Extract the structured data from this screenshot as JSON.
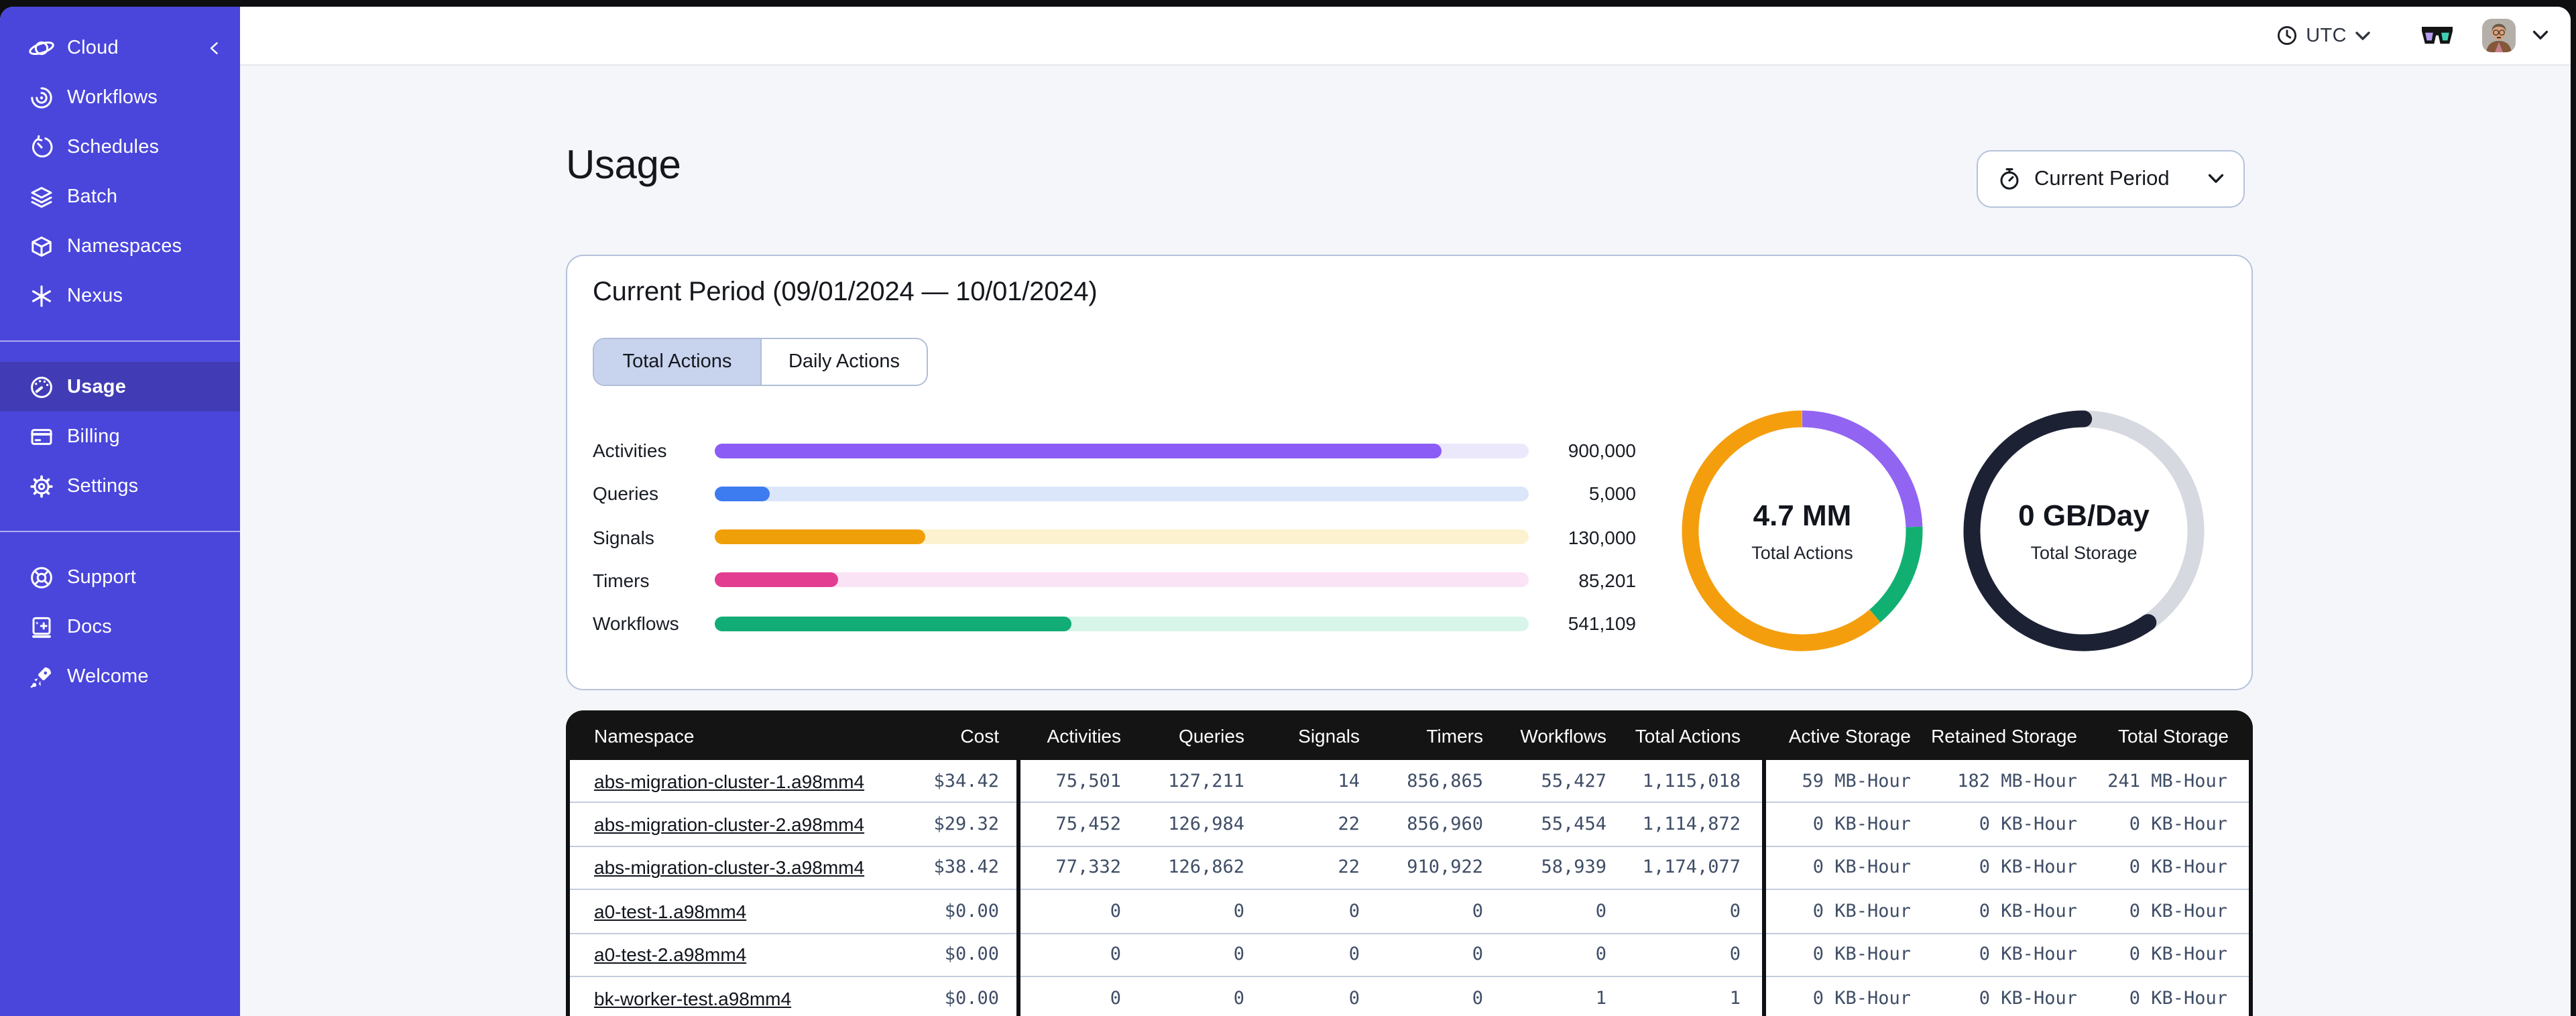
{
  "topbar": {
    "timezone_label": "UTC"
  },
  "sidebar": {
    "header": {
      "label": "Cloud"
    },
    "primary": [
      {
        "label": "Workflows"
      },
      {
        "label": "Schedules"
      },
      {
        "label": "Batch"
      },
      {
        "label": "Namespaces"
      },
      {
        "label": "Nexus"
      }
    ],
    "account": [
      {
        "label": "Usage",
        "active": true
      },
      {
        "label": "Billing",
        "active": false
      },
      {
        "label": "Settings",
        "active": false
      }
    ],
    "help": [
      {
        "label": "Support"
      },
      {
        "label": "Docs"
      },
      {
        "label": "Welcome"
      }
    ]
  },
  "page": {
    "title": "Usage",
    "period_selector_label": "Current Period"
  },
  "usage_card": {
    "title": "Current Period (09/01/2024 — 10/01/2024)",
    "tabs": [
      {
        "label": "Total Actions",
        "active": true
      },
      {
        "label": "Daily Actions",
        "active": false
      }
    ]
  },
  "chart_data": [
    {
      "type": "bar",
      "orientation": "horizontal",
      "title": "Actions by type (current period)",
      "categories": [
        "Activities",
        "Queries",
        "Signals",
        "Timers",
        "Workflows"
      ],
      "values": [
        900000,
        5000,
        130000,
        85201,
        541109
      ],
      "value_labels": [
        "900,000",
        "5,000",
        "130,000",
        "85,201",
        "541,109"
      ],
      "fill_fractions": [
        0.893,
        0.067,
        0.258,
        0.152,
        0.439
      ],
      "bar_colors": [
        "#8b5cf6",
        "#3d7cf0",
        "#ef9f08",
        "#e33d92",
        "#12ac77"
      ],
      "track_colors": [
        "#ece8fc",
        "#dbe6fa",
        "#fdf2cf",
        "#fbe3f6",
        "#d8f5e9"
      ]
    },
    {
      "type": "pie",
      "variant": "donut",
      "center_value": "4.7 MM",
      "center_label": "Total Actions",
      "segments": [
        {
          "name": "activities",
          "color": "#9264f2",
          "start_deg": 0,
          "end_deg": 88
        },
        {
          "name": "workflows",
          "color": "#12af72",
          "start_deg": 88,
          "end_deg": 139.5
        },
        {
          "name": "signals",
          "color": "#f49e0d",
          "start_deg": 139.5,
          "end_deg": 360
        }
      ]
    },
    {
      "type": "pie",
      "variant": "donut",
      "center_value": "0 GB/Day",
      "center_label": "Total Storage",
      "base_color": "#d6d9df",
      "segments": [
        {
          "name": "storage-used",
          "color": "#1c2134",
          "start_deg": 145,
          "end_deg": 360,
          "linecap": "round"
        }
      ]
    }
  ],
  "table": {
    "columns": [
      "Namespace",
      "Cost",
      "Activities",
      "Queries",
      "Signals",
      "Timers",
      "Workflows",
      "Total Actions",
      "Active Storage",
      "Retained Storage",
      "Total Storage"
    ],
    "rows": [
      [
        "abs-migration-cluster-1.a98mm4",
        "$34.42",
        "75,501",
        "127,211",
        "14",
        "856,865",
        "55,427",
        "1,115,018",
        "59 MB-Hour",
        "182 MB-Hour",
        "241 MB-Hour"
      ],
      [
        "abs-migration-cluster-2.a98mm4",
        "$29.32",
        "75,452",
        "126,984",
        "22",
        "856,960",
        "55,454",
        "1,114,872",
        "0 KB-Hour",
        "0 KB-Hour",
        "0 KB-Hour"
      ],
      [
        "abs-migration-cluster-3.a98mm4",
        "$38.42",
        "77,332",
        "126,862",
        "22",
        "910,922",
        "58,939",
        "1,174,077",
        "0 KB-Hour",
        "0 KB-Hour",
        "0 KB-Hour"
      ],
      [
        "a0-test-1.a98mm4",
        "$0.00",
        "0",
        "0",
        "0",
        "0",
        "0",
        "0",
        "0 KB-Hour",
        "0 KB-Hour",
        "0 KB-Hour"
      ],
      [
        "a0-test-2.a98mm4",
        "$0.00",
        "0",
        "0",
        "0",
        "0",
        "0",
        "0",
        "0 KB-Hour",
        "0 KB-Hour",
        "0 KB-Hour"
      ],
      [
        "bk-worker-test.a98mm4",
        "$0.00",
        "0",
        "0",
        "0",
        "0",
        "1",
        "1",
        "0 KB-Hour",
        "0 KB-Hour",
        "0 KB-Hour"
      ]
    ]
  }
}
